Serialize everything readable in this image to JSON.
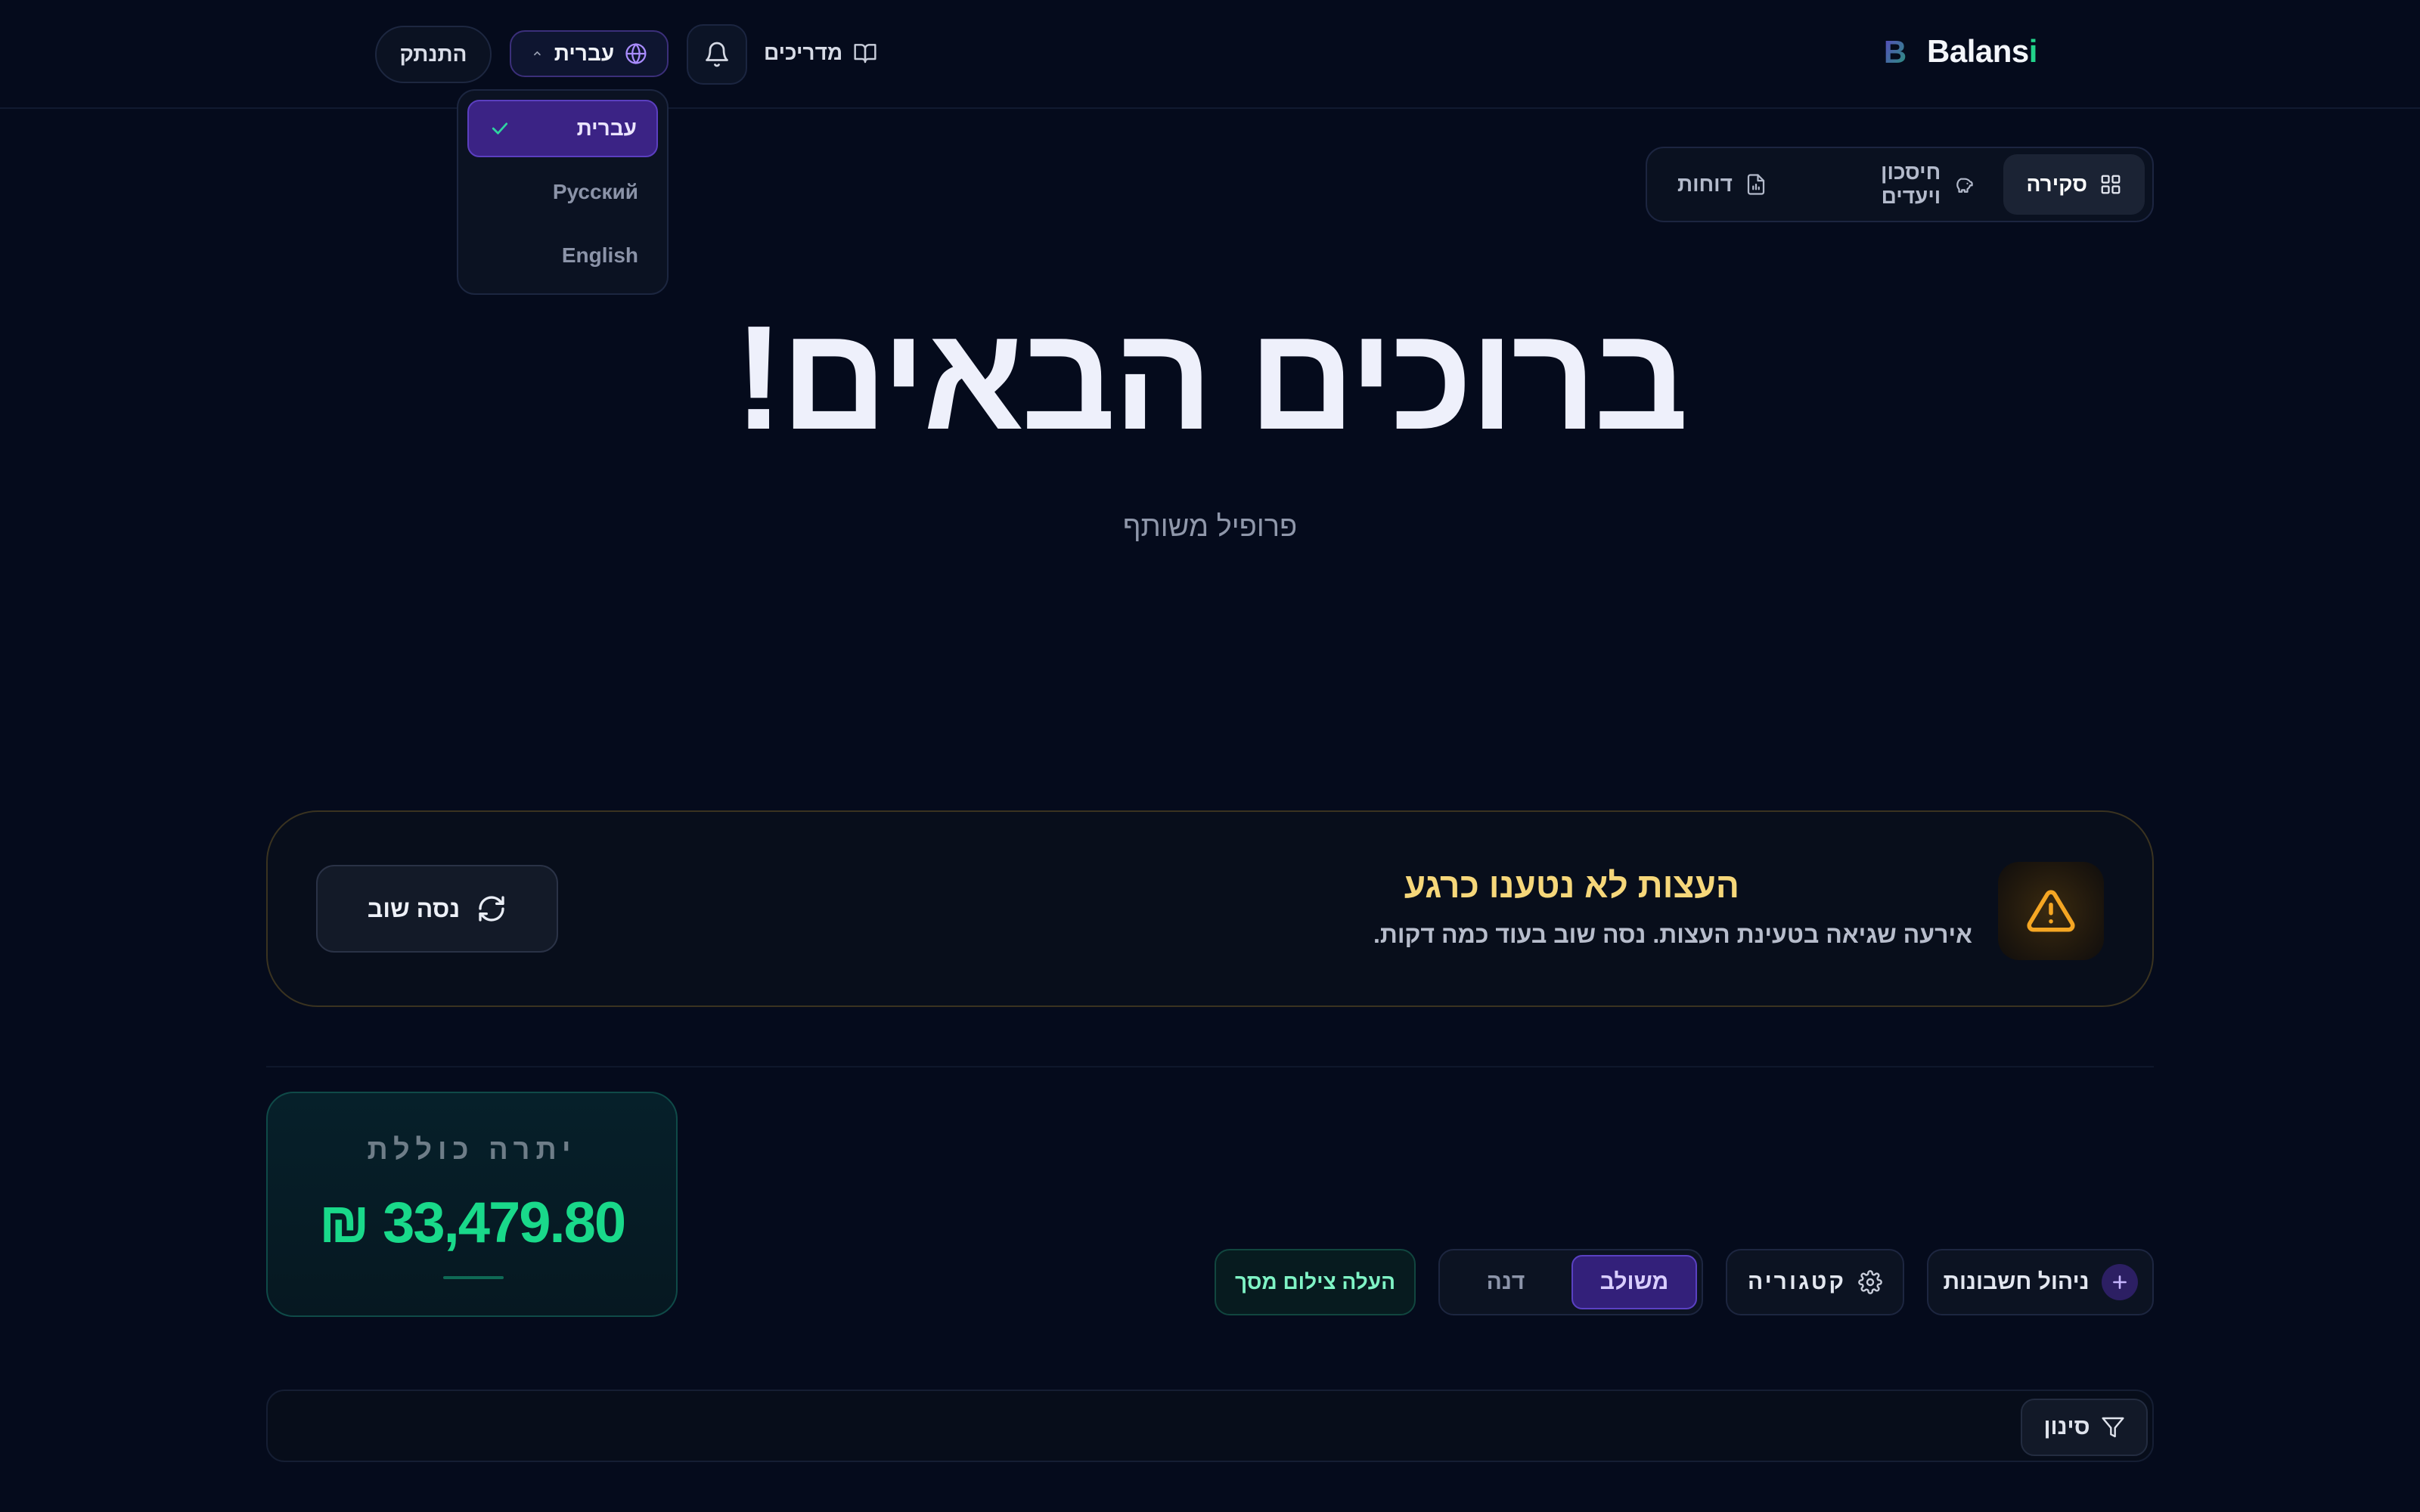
{
  "brand": {
    "name_main": "Balans",
    "name_accent": "i",
    "logo_letter": "B"
  },
  "header": {
    "guides_label": "מדריכים",
    "language_label": "עברית",
    "logout_label": "התנתק"
  },
  "language_menu": {
    "items": [
      {
        "label": "עברית",
        "selected": true
      },
      {
        "label": "Русский",
        "selected": false
      },
      {
        "label": "English",
        "selected": false
      }
    ]
  },
  "tabs": [
    {
      "label": "סקירה",
      "icon": "grid-icon",
      "active": true
    },
    {
      "label": "חיסכון ויעדים",
      "icon": "piggy-bank-icon",
      "active": false
    },
    {
      "label": "דוחות",
      "icon": "report-icon",
      "active": false
    }
  ],
  "hero": {
    "title": "ברוכים הבאים!",
    "subtitle": "פרופיל משותף"
  },
  "alert": {
    "title": "העצות לא נטענו כרגע",
    "message": "אירעה שגיאה בטעינת העצות. נסה שוב בעוד כמה דקות.",
    "retry_label": "נסה שוב",
    "icon": "warning-icon"
  },
  "balance": {
    "label": "יתרה כוללת",
    "value": "₪ 33,479.80"
  },
  "controls": {
    "accounts_label": "ניהול חשבונות",
    "category_label": "קטגוריה",
    "mode_options": [
      {
        "label": "משולב",
        "active": true
      },
      {
        "label": "דנה",
        "active": false
      }
    ],
    "upload_label": "העלה צילום מסך"
  },
  "filter": {
    "label": "סינון"
  },
  "colors": {
    "background": "#050b1c",
    "accent_purple": "#5b3fc0",
    "accent_green": "#19d98a",
    "warning_yellow": "#f6d77a",
    "warning_icon": "#f5a623"
  }
}
